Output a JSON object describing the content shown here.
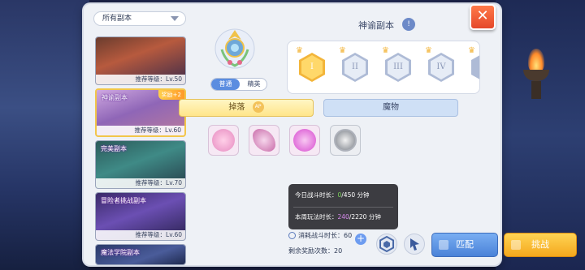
{
  "filter": {
    "label": "所有副本"
  },
  "dungeons": [
    {
      "name": "",
      "level": "推荐等级：Lv.50",
      "reward": ""
    },
    {
      "name": "神谕副本",
      "level": "推荐等级：Lv.60",
      "reward": "奖励+2"
    },
    {
      "name": "完美副本",
      "level": "推荐等级：Lv.70",
      "reward": ""
    },
    {
      "name": "冒险者挑战副本",
      "level": "推荐等级：Lv.60",
      "reward": ""
    },
    {
      "name": "魔法学院副本",
      "level": "",
      "reward": ""
    }
  ],
  "main": {
    "title": "神谕副本",
    "info": "!",
    "modes": [
      "普通",
      "精英"
    ],
    "tiers": [
      "I",
      "II",
      "III",
      "IV"
    ],
    "tabs": {
      "drop": "掉落",
      "drop_badge": "AP",
      "monster": "魔物"
    }
  },
  "tooltip": {
    "daily_label": "今日战斗时长：",
    "daily_now": "0",
    "daily_total": "/450",
    "daily_unit": "分钟",
    "weekly_label": "本周玩法时长：",
    "weekly_now": "240",
    "weekly_total": "/2220",
    "weekly_unit": "分钟"
  },
  "footer": {
    "consume_label": "消耗战斗时长：",
    "consume_value": "60",
    "remaining_label": "剩余奖励次数：",
    "remaining_value": "20",
    "match_label": "匹配",
    "challenge_label": "挑战",
    "close": "✕",
    "plus": "+"
  },
  "colors": {
    "accent_blue": "#4a82d8",
    "accent_gold": "#f4a81d",
    "close_red": "#e5482a"
  }
}
